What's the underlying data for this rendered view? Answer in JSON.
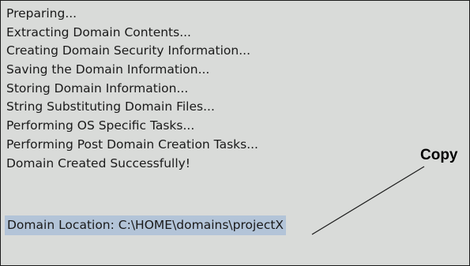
{
  "log": {
    "lines": [
      "Preparing...",
      "Extracting Domain Contents...",
      "Creating Domain Security Information...",
      "Saving the Domain Information...",
      "Storing Domain Information...",
      "String Substituting Domain Files...",
      "Performing OS Specific Tasks...",
      "Performing Post Domain Creation Tasks...",
      "Domain Created Successfully!"
    ],
    "location": "Domain Location: C:\\HOME\\domains\\projectX",
    "selection_color": "#b3c4d8"
  },
  "annotation": {
    "label": "Copy",
    "icon": "callout-pointer-line"
  }
}
